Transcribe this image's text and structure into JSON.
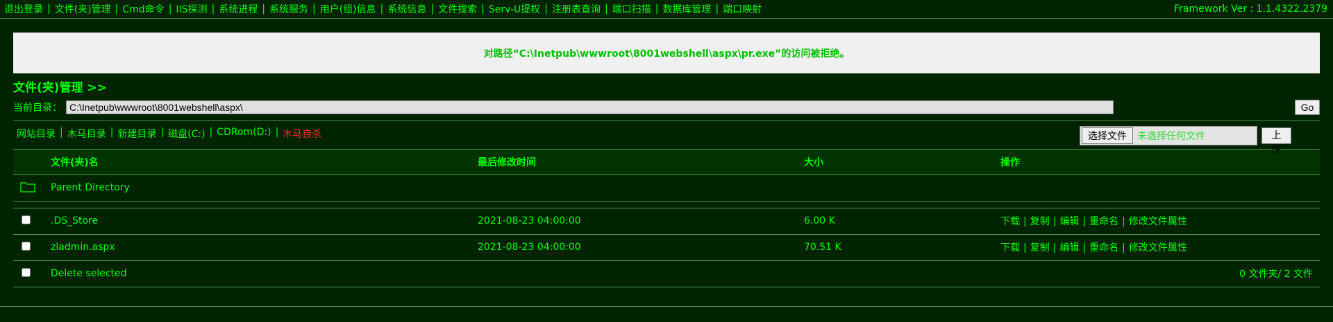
{
  "nav": {
    "items": [
      "退出登录",
      "文件(夹)管理",
      "Cmd命令",
      "IIS探测",
      "系统进程",
      "系统服务",
      "用户(组)信息",
      "系统信息",
      "文件搜索",
      "Serv-U提权",
      "注册表查询",
      "端口扫描",
      "数据库管理",
      "端口映射"
    ],
    "separator": "|"
  },
  "framework": "Framework Ver : 1.1.4322.2379",
  "message": "对路径“C:\\Inetpub\\wwwroot\\8001webshell\\aspx\\pr.exe”的访问被拒绝。",
  "section_title": "文件(夹)管理 >>",
  "current_dir": {
    "label": "当前目录：",
    "value": "C:\\Inetpub\\wwwroot\\8001webshell\\aspx\\",
    "go_label": "Go"
  },
  "quick_links": {
    "items": [
      "网站目录",
      "木马目录",
      "新建目录",
      "磁盘(C:)",
      "CDRom(D:)"
    ],
    "danger": "木马自杀"
  },
  "upload": {
    "choose_label": "选择文件",
    "no_file_text": "未选择任何文件",
    "upload_label": "上传"
  },
  "table": {
    "headers": {
      "name": "文件(夹)名",
      "modified": "最后修改时间",
      "size": "大小",
      "ops": "操作"
    },
    "parent_label": "Parent Directory",
    "files": [
      {
        "name": ".DS_Store",
        "modified": "2021-08-23 04:00:00",
        "size": "6.00 K"
      },
      {
        "name": "zladmin.aspx",
        "modified": "2021-08-23 04:00:00",
        "size": "70.51 K"
      }
    ],
    "ops": [
      "下载",
      "复制",
      "编辑",
      "重命名",
      "修改文件属性"
    ],
    "delete_label": "Delete selected",
    "summary": "0 文件夹/ 2 文件"
  },
  "colors": {
    "background": "#002400",
    "text": "#00ff00",
    "danger": "#ff2a2a",
    "message_bg": "#f0f0f0"
  }
}
